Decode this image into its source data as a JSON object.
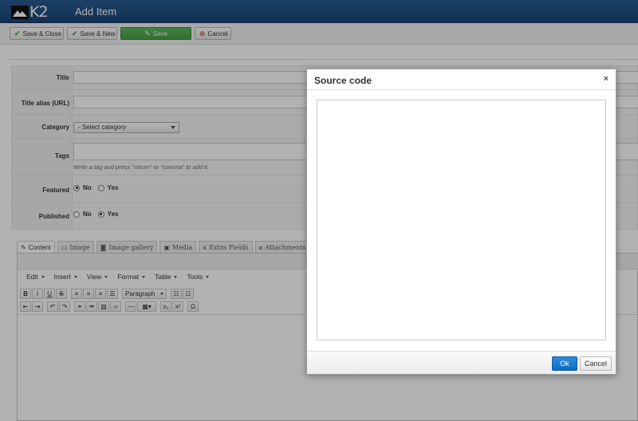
{
  "header": {
    "logo_text": "K2",
    "title": "Add Item"
  },
  "toolbar": {
    "save_close": "Save & Close",
    "save_new": "Save & New",
    "save": "Save",
    "cancel": "Cancel"
  },
  "form": {
    "title_label": "Title",
    "alias_label": "Title alias (URL)",
    "category_label": "Category",
    "category_value": "- Select category",
    "tags_label": "Tags",
    "tags_hint": "Write a tag and press \"return\" or \"comma\" to add it.",
    "featured_label": "Featured",
    "published_label": "Published",
    "no_label": "No",
    "yes_label": "Yes"
  },
  "tabs": [
    "Content",
    "Image",
    "Image gallery",
    "Media",
    "Extra Fields",
    "Attachments"
  ],
  "editor": {
    "menus": [
      "Edit",
      "Insert",
      "View",
      "Format",
      "Table",
      "Tools"
    ],
    "paragraph": "Paragraph"
  },
  "modal": {
    "title": "Source code",
    "close": "×",
    "ok": "Ok",
    "cancel": "Cancel"
  }
}
